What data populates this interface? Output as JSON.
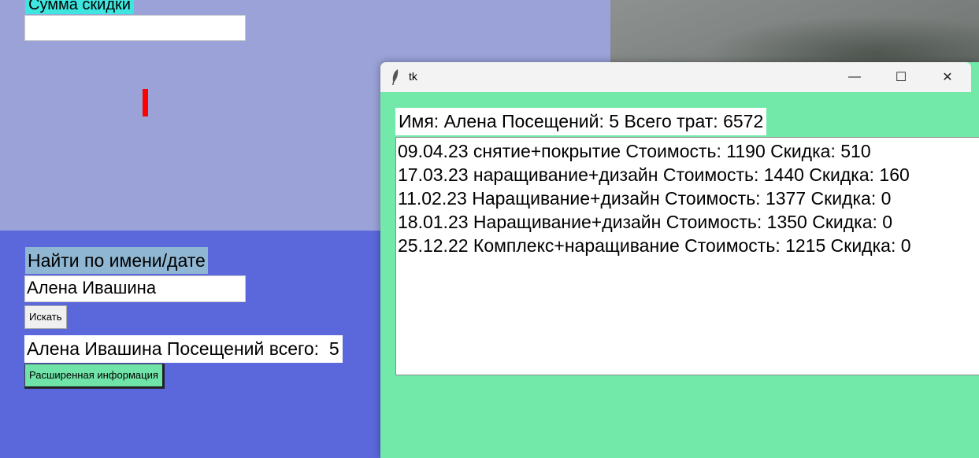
{
  "main_window": {
    "discount_label": "Сумма скидки",
    "discount_value": "",
    "find_label": "Найти по имени/дате",
    "name_value": "Алена Ивашина",
    "search_button": "Искать",
    "result_text": "Алена Ивашина Посещений всего:  5",
    "extended_button": "Расширенная информация"
  },
  "popup": {
    "title": "tk",
    "summary": "Имя: Алена Посещений: 5 Всего трат: 6572",
    "visits": [
      "09.04.23 снятие+покрытие Стоимость: 1190 Скидка: 510",
      "17.03.23 наращивание+дизайн Стоимость: 1440 Скидка: 160",
      "11.02.23 Наращивание+дизайн Стоимость: 1377 Скидка: 0",
      "18.01.23 Наращивание+дизайн Стоимость: 1350 Скидка: 0",
      "25.12.22 Комплекс+наращивание Стоимость: 1215 Скидка: 0"
    ],
    "controls": {
      "minimize": "—",
      "maximize": "☐",
      "close": "✕"
    }
  },
  "colors": {
    "main_top_bg": "#9aa2d8",
    "main_bottom_bg": "#5b68dc",
    "popup_bg": "#72e9a8",
    "discount_label_bg": "#3fe6df",
    "find_label_bg": "#8fb6d2",
    "accent_red": "#ff0000"
  }
}
